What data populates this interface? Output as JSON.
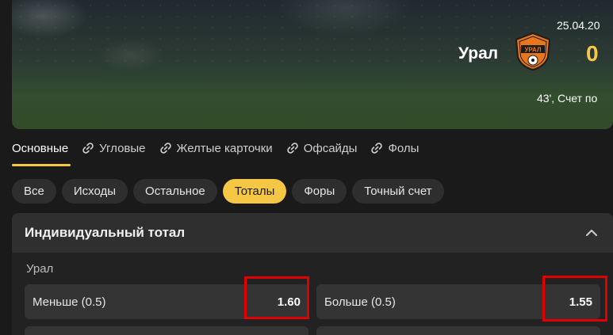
{
  "hero": {
    "date": "25.04.20",
    "team_name": "Урал",
    "logo_text": "УРАЛ",
    "score": "0",
    "status": "43', Счет по"
  },
  "tabs": [
    {
      "label": "Основные",
      "icon": null,
      "active": true
    },
    {
      "label": "Угловые",
      "icon": "link-icon"
    },
    {
      "label": "Желтые карточки",
      "icon": "link-icon"
    },
    {
      "label": "Офсайды",
      "icon": "link-icon"
    },
    {
      "label": "Фолы",
      "icon": "link-icon"
    }
  ],
  "filters": [
    {
      "label": "Все"
    },
    {
      "label": "Исходы"
    },
    {
      "label": "Остальное"
    },
    {
      "label": "Тоталы",
      "active": true
    },
    {
      "label": "Форы"
    },
    {
      "label": "Точный счет"
    }
  ],
  "market": {
    "title": "Индивидуальный тотал",
    "group_label": "Урал",
    "odds": [
      {
        "name": "Меньше (0.5)",
        "value": "1.60"
      },
      {
        "name": "Больше (0.5)",
        "value": "1.55"
      }
    ]
  },
  "colors": {
    "accent": "#f6c744",
    "highlight": "#e00000",
    "background": "#1a1a1a"
  }
}
